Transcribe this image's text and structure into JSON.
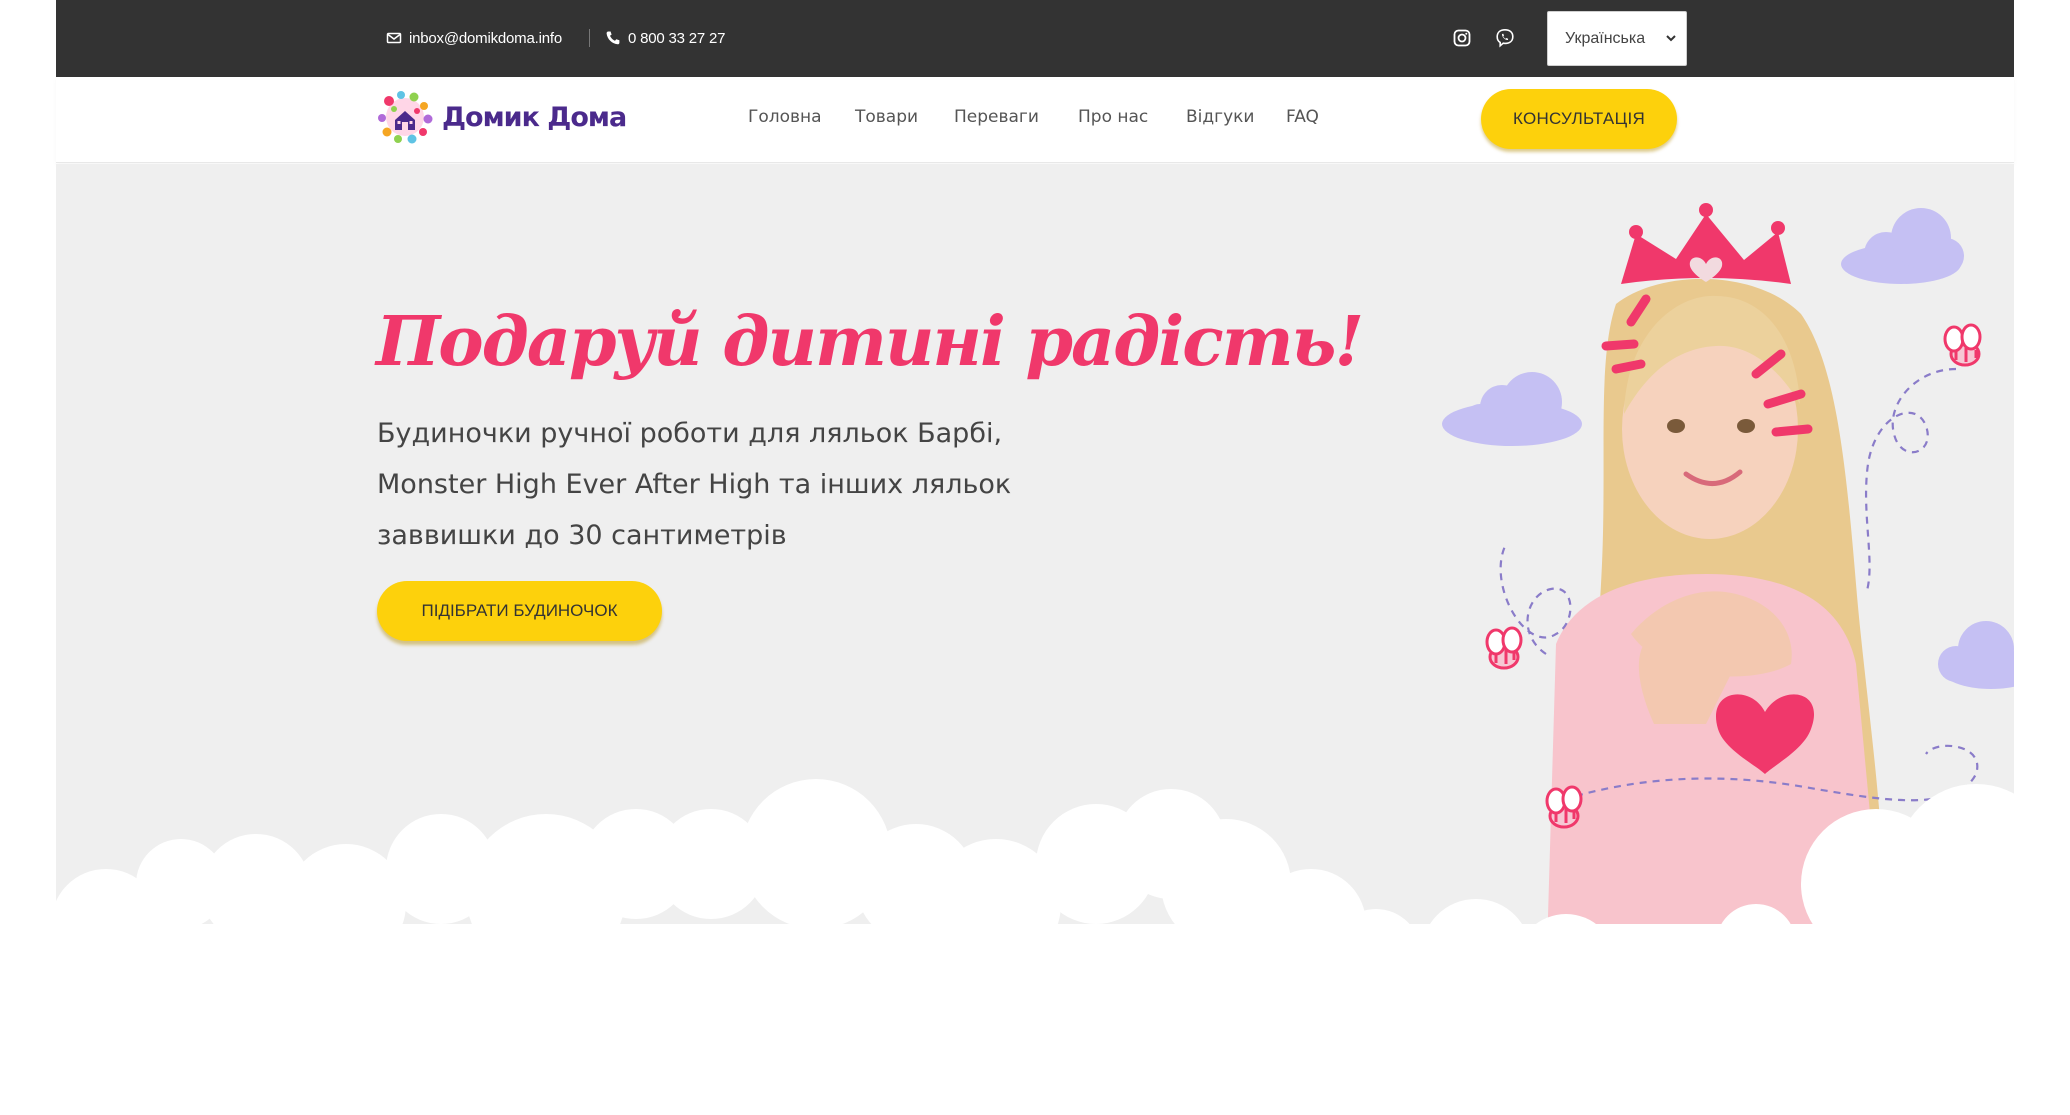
{
  "topbar": {
    "email": "inbox@domikdoma.info",
    "phone": "0 800 33 27 27",
    "icons": [
      "mail-icon",
      "phone-icon",
      "instagram-icon",
      "viber-icon"
    ],
    "language": "Українська"
  },
  "header": {
    "logo_text": "Домик Дома",
    "nav": [
      "Головна",
      "Товари",
      "Переваги",
      "Про нас",
      "Відгуки",
      "FAQ"
    ],
    "consult_label": "КОНСУЛЬТАЦІЯ"
  },
  "hero": {
    "title": "Подаруй дитині радість!",
    "subtitle_lines": [
      "Будиночки ручної роботи для ляльок Барбі,",
      "Monster High Ever After High та інших ляльок",
      "заввишки до 30 сантиметрів"
    ],
    "cta_label": "ПІДІБРАТИ БУДИНОЧОК"
  },
  "colors": {
    "topbar_bg": "#333333",
    "accent_yellow": "#fdd10c",
    "headline_pink": "#f0386b",
    "logo_purple": "#4b2a8c",
    "hero_bg": "#efefef",
    "cloud_lilac": "#c5c0f3"
  }
}
